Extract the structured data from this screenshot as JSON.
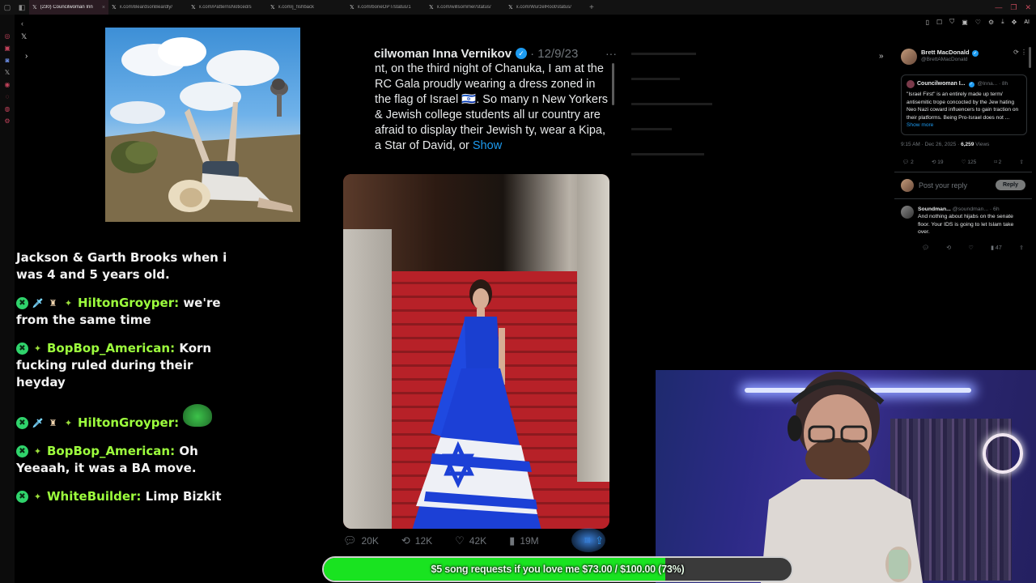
{
  "browser": {
    "tabs": [
      {
        "label": "(230) Councilwoman Inn",
        "active": true
      },
      {
        "label": "x.com/BeardsonBeardly/",
        "active": false
      },
      {
        "label": "x.com/PatternsNoticed/s",
        "active": false
      },
      {
        "label": "x.com/j_fishback",
        "active": false
      },
      {
        "label": "x.com/boneOPT/status/1",
        "active": false
      },
      {
        "label": "x.com/willsommer/status/",
        "active": false
      },
      {
        "label": "x.com/WurzelRoot/status/",
        "active": false
      }
    ],
    "new_tab": "+",
    "toolbar_ai": "AI"
  },
  "chat": {
    "messages": [
      {
        "user": "",
        "text": "Jackson & Garth Brooks when i was 4 and 5 years old.",
        "badges": []
      },
      {
        "user": "HiltonGroyper:",
        "text": "we're from the same time",
        "badges": [
          "circle",
          "sword",
          "cake",
          "diamond"
        ]
      },
      {
        "user": "BopBop_American:",
        "text": "Korn fucking ruled during their heyday",
        "badges": [
          "circle",
          "diamond"
        ]
      },
      {
        "user": "HiltonGroyper:",
        "text": "",
        "badges": [
          "circle",
          "sword",
          "cake",
          "diamond"
        ],
        "emote": true
      },
      {
        "user": "BopBop_American:",
        "text": "Oh Yeeaah, it was a BA move.",
        "badges": [
          "circle",
          "diamond"
        ]
      },
      {
        "user": "WhiteBuilder:",
        "text": "Limp Bizkit",
        "badges": [
          "circle",
          "diamond"
        ]
      }
    ]
  },
  "tweet": {
    "name": "cilwoman Inna Vernikov",
    "date": "12/9/23",
    "text": "nt, on the third night of Chanuka, I am at the RC Gala proudly wearing a dress zoned in the flag of Israel 🇮🇱. So many n New Yorkers & Jewish college students all ur country are afraid to display their Jewish ty, wear a Kipa, a Star of David, or",
    "show_more": "Show",
    "replies": "20K",
    "reposts": "12K",
    "likes": "42K",
    "views": "19M"
  },
  "reply_panel": {
    "author_name": "Brett MacDonald",
    "author_handle": "@BrettAMacDonald",
    "quote_name": "Councilwoman I...",
    "quote_meta": "@Inna... · 8h",
    "quote_text": "\"Israel First\" is an entirely made up term/ antisemitic trope concocted by the Jew hating Neo Nazi coward influencers to gain traction on their platforms. Being Pro-Israel does not ...",
    "quote_show_more": "Show more",
    "stamp": "9:15 AM · Dec 26, 2025 · ",
    "stamp_views": "6,259",
    "stamp_views_label": " Views",
    "counts": {
      "replies": "2",
      "reposts": "19",
      "likes": "125",
      "bookmarks": "2"
    },
    "reply_placeholder": "Post your reply",
    "reply_button": "Reply",
    "comment_name": "Soundman...",
    "comment_meta": "@soundman... · 6h",
    "comment_text": "And nothing about hijabs on the senate floor. Your IDS is going to let Islam take over.",
    "comment_views": "47"
  },
  "goal": {
    "text": "$5 song requests if you love me $73.00 / $100.00 (73%)",
    "progress": 0.73,
    "color": "#19e320"
  }
}
